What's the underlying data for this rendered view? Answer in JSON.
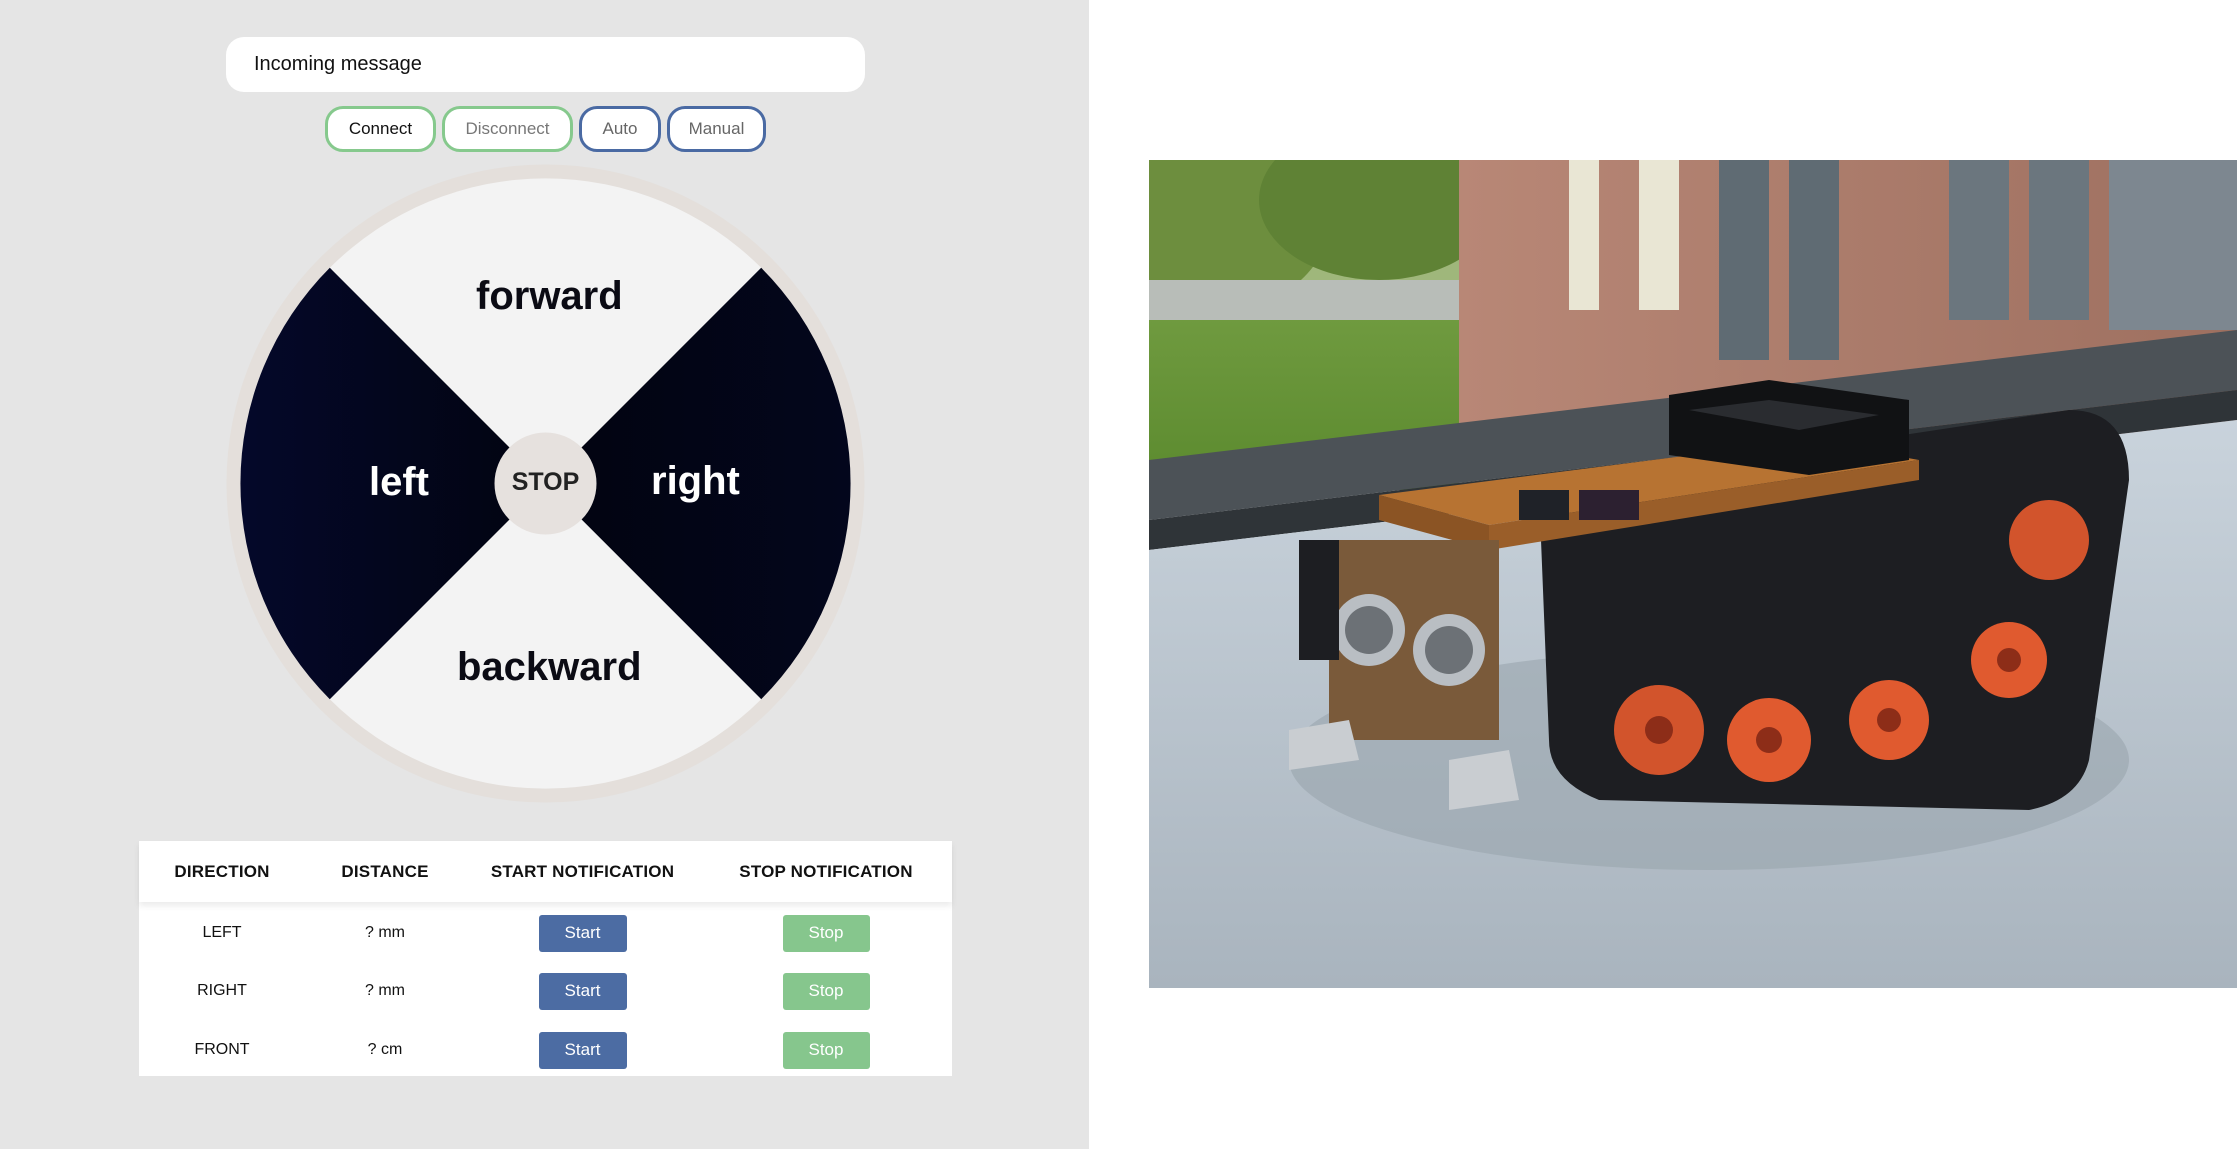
{
  "message": {
    "text": "Incoming message"
  },
  "controls": {
    "connect_label": "Connect",
    "disconnect_label": "Disconnect",
    "auto_label": "Auto",
    "manual_label": "Manual"
  },
  "wheel": {
    "forward": "forward",
    "backward": "backward",
    "left": "left",
    "right": "right",
    "stop": "STOP"
  },
  "table": {
    "headers": [
      "DIRECTION",
      "DISTANCE",
      "START NOTIFICATION",
      "STOP NOTIFICATION"
    ],
    "rows": [
      {
        "direction": "LEFT",
        "distance": "? mm",
        "start": "Start",
        "stop": "Stop"
      },
      {
        "direction": "RIGHT",
        "distance": "? mm",
        "start": "Start",
        "stop": "Stop"
      },
      {
        "direction": "FRONT",
        "distance": "? cm",
        "start": "Start",
        "stop": "Stop"
      }
    ]
  },
  "colors": {
    "panel_bg": "#e5e5e5",
    "green_accent": "#86c98d",
    "blue_accent": "#4a6aa3",
    "wedge_dark": "#050a24",
    "wedge_light": "#f3f3f3"
  }
}
